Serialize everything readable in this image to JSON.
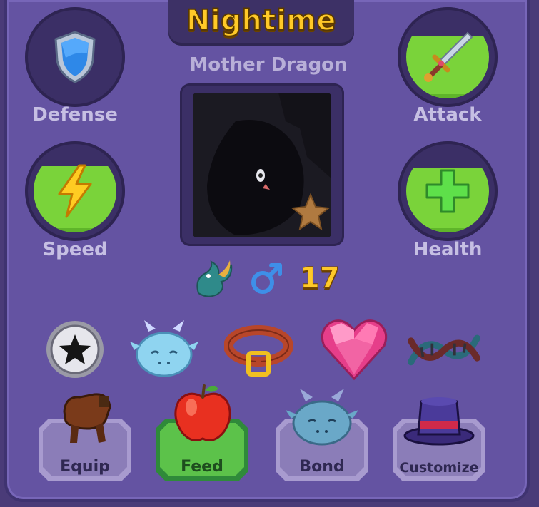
{
  "header": {
    "title": "Nightime",
    "subtitle": "Mother Dragon"
  },
  "stats": {
    "defense": {
      "label": "Defense",
      "fill": 0.0,
      "icon": "shield-icon"
    },
    "attack": {
      "label": "Attack",
      "fill": 0.75,
      "icon": "sword-icon"
    },
    "speed": {
      "label": "Speed",
      "fill": 0.8,
      "icon": "lightning-icon"
    },
    "health": {
      "label": "Health",
      "fill": 0.78,
      "icon": "plus-icon"
    }
  },
  "pet": {
    "level": "17",
    "gender_icon": "male-icon",
    "species_icon": "dragon-icon"
  },
  "accessories": [
    "star-badge-icon",
    "dragon-face-icon",
    "collar-icon",
    "heart-gem-icon",
    "dna-icon"
  ],
  "actions": {
    "equip": "Equip",
    "feed": "Feed",
    "bond": "Bond",
    "customize": "Customize"
  },
  "colors": {
    "accent": "#ffc928",
    "fill_green": "#7ad33a",
    "panel": "#6453a2"
  }
}
